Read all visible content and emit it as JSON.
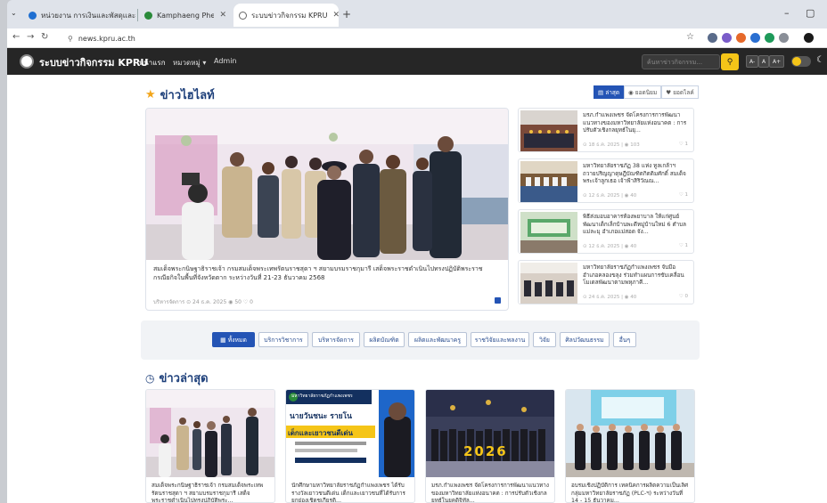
{
  "browser": {
    "tabs": [
      {
        "title": "หน่วยงาน การเงินและพัสดุและงานคลาง",
        "color": "#1f6fd1"
      },
      {
        "title": "Kamphaeng Phet Rajabhat Uni...",
        "color": "#2a8a3a"
      },
      {
        "title": "ระบบข่าวกิจกรรม KPRU",
        "color": "#888888"
      }
    ],
    "url": "news.kpru.ac.th"
  },
  "navbar": {
    "brand": "ระบบข่าวกิจกรรม KPRU",
    "links": [
      "หน้าแรก",
      "หมวดหมู่ ▾",
      "Admin"
    ],
    "search_placeholder": "ค้นหาข่าวกิจกรรม...",
    "font_buttons": [
      "A-",
      "A",
      "A+"
    ]
  },
  "highlight": {
    "title": "ข่าวไฮไลท์",
    "view_tabs": [
      "ล่าสุด",
      "ยอดนิยม",
      "ยอดไลค์"
    ],
    "main": {
      "text": "สมเด็จพระกนิษฐาธิราชเจ้า กรมสมเด็จพระเทพรัตนราชสุดา ฯ สยามบรมราชกุมารี เสด็จพระราชดำเนินไปทรงปฏิบัติพระราชกรณียกิจในพื้นที่จังหวัดตาก ระหว่างวันที่ 21-23 ธันวาคม 2568",
      "meta": "บริหารจัดการ  ⊙ 24 ธ.ค. 2025  ◉ 50  ♡ 0"
    },
    "side": [
      {
        "title": "มรภ.กำแพงเพชร จัดโครงการการพัฒนาแนวทางของมหาวิทยาลัยแห่งอนาคต : การปรับตัวเชิงกลยุทธ์ในยุ...",
        "meta": "⊙ 18 ธ.ค. 2025 | ◉ 103",
        "count": "♡ 1"
      },
      {
        "title": "มหาวิทยาลัยราชภัฏ 38 แห่ง ทูลเกล้าฯ ถวายปริญญาดุษฎีบัณฑิตกิตติมศักดิ์ สมเด็จพระเจ้าลูกเธอ เจ้าฟ้าสิริวัณณ...",
        "meta": "⊙ 12 ธ.ค. 2025 | ◉ 40",
        "count": "♡ 1"
      },
      {
        "title": "พิธีส่งมอบอาคารห้องพยาบาล ให้แก่ศูนย์พัฒนาเด็กเล็กบ้านพะดีหมู่บ้านใหม่ 6 ตำบลแม่ละมุ อำเภอแม่สอด จัง...",
        "meta": "⊙ 12 ธ.ค. 2025 | ◉ 40",
        "count": "♡ 1"
      },
      {
        "title": "มหาวิทยาลัยราชภัฏกำแพงเพชร จับมือ อำเภอคลองขลุง ร่วมทำแผนการขับเคลื่อนโมเดลพัฒนาตามพหุภาคี...",
        "meta": "⊙ 24 ธ.ค. 2025 | ◉ 40",
        "count": "♡ 0"
      }
    ]
  },
  "categories": {
    "all_label": "ทั้งหมด",
    "items": [
      "บริการวิชาการ",
      "บริหารจัดการ",
      "ผลิตบัณฑิต",
      "ผลิตและพัฒนาครู",
      "ราชวิจัยและพลงาน",
      "วิจัย",
      "ศิลปวัฒนธรรม",
      "อื่นๆ"
    ]
  },
  "latest": {
    "title": "ข่าวล่าสุด",
    "cards": [
      {
        "text": "สมเด็จพระกนิษฐาธิราชเจ้า กรมสมเด็จพระเทพรัตนราชสุดา ฯ สยามบรมราชกุมารี เสด็จพระราชดำเนินไปทรงปฏิบัติพระ..."
      },
      {
        "text": "นักศึกษามหาวิทยาลัยราชภัฏกำแพงเพชร ได้รับรางวัลเยาวชนดีเด่น เด็กและเยาวชนที่ได้รับการยกย่องเชิดชูเกียรติ..."
      },
      {
        "text": "มรภ.กำแพงเพชร จัดโครงการการพัฒนาแนวทางของมหาวิทยาลัยแห่งอนาคต : การปรับตัวเชิงกลยุทธ์ในยุคดิจิทัล..."
      },
      {
        "text": "อบรมเชิงปฏิบัติการ เทคนิคการผลิตความเป็นเลิศ กลุ่มมหาวิทยาลัยราชภัฏ (PLC-ฯ) ระหว่างวันที่ 14 - 15 ธันวาคม..."
      }
    ],
    "poster": {
      "org": "มหาวิทยาลัยราชภัฏกำแพงเพชร",
      "name": "นายวันชนะ รายโน",
      "award": "เด็กและเยาวชนดีเด่น"
    },
    "banner_year": "2026"
  },
  "colors": {
    "accent": "#2454b5",
    "title": "#1d3f7a",
    "star": "#f2a51a",
    "navbar": "#262626"
  }
}
